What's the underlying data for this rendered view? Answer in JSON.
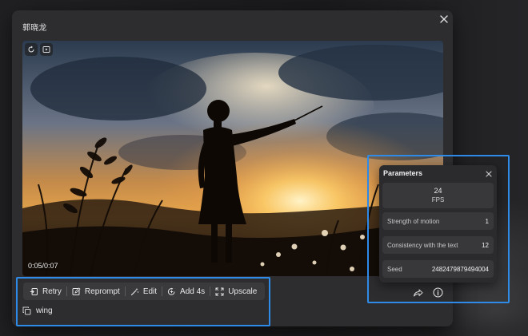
{
  "dialog": {
    "title": "郭晓龙"
  },
  "video": {
    "time": "0:05/0:07"
  },
  "actions": [
    {
      "id": "retry",
      "label": "Retry",
      "icon": "retry-icon"
    },
    {
      "id": "reprompt",
      "label": "Reprompt",
      "icon": "edit-pencil-icon"
    },
    {
      "id": "edit",
      "label": "Edit",
      "icon": "magic-wand-icon"
    },
    {
      "id": "add4s",
      "label": "Add 4s",
      "icon": "add-time-icon"
    },
    {
      "id": "upscale",
      "label": "Upscale",
      "icon": "expand-icon"
    }
  ],
  "prompt": {
    "text": "wing",
    "icon": "copy-icon"
  },
  "parameters": {
    "title": "Parameters",
    "fps": {
      "value": "24",
      "label": "FPS"
    },
    "rows": [
      {
        "label": "Strength of motion",
        "value": "1"
      },
      {
        "label": "Consistency with the text",
        "value": "12"
      },
      {
        "label": "Seed",
        "value": "2482479879494004"
      }
    ]
  },
  "colors": {
    "highlight": "#2f8be8",
    "dialog_bg": "#2d2d30",
    "panel_bg": "#2b2b2e"
  }
}
